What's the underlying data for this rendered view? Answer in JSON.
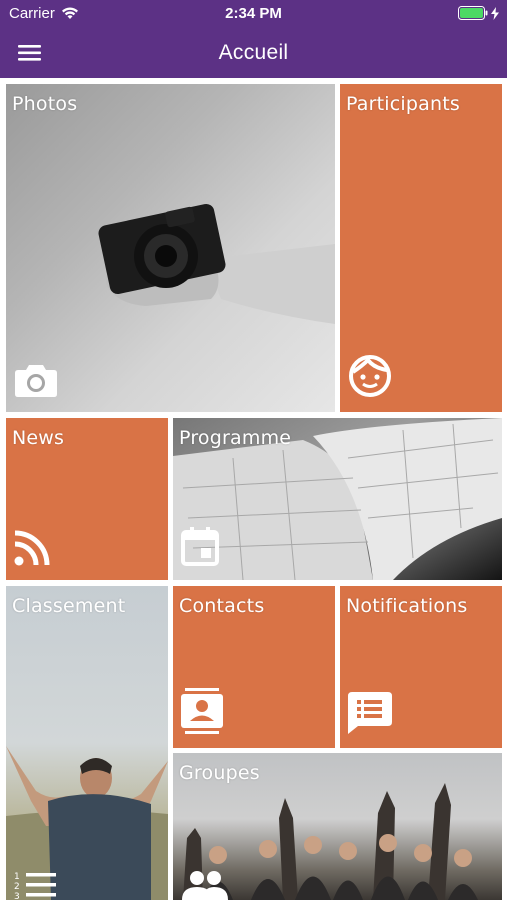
{
  "status": {
    "carrier": "Carrier",
    "time": "2:34 PM"
  },
  "nav": {
    "title": "Accueil"
  },
  "tiles": {
    "photos": "Photos",
    "participants": "Participants",
    "news": "News",
    "programme": "Programme",
    "classement": "Classement",
    "contacts": "Contacts",
    "notifications": "Notifications",
    "groupes": "Groupes"
  },
  "colors": {
    "nav": "#5c3185",
    "tile": "#d97346"
  },
  "icons": {
    "photos": "camera-icon",
    "participants": "face-icon",
    "news": "rss-icon",
    "programme": "calendar-icon",
    "classement": "list-numbered-icon",
    "contacts": "contact-card-icon",
    "notifications": "message-list-icon",
    "groupes": "group-icon"
  }
}
